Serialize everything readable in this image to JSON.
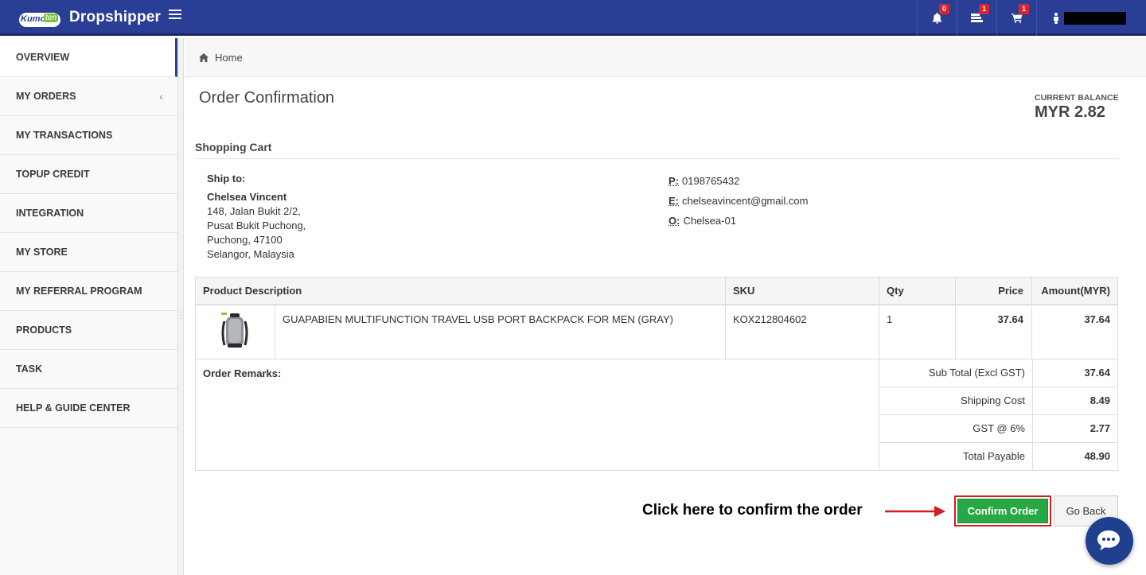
{
  "header": {
    "brand": "Dropshipper",
    "logo_text_a": "Kumo",
    "logo_text_b": "ten",
    "notifications": [
      {
        "icon": "bell-icon",
        "count": "0"
      },
      {
        "icon": "messages-icon",
        "count": "1"
      },
      {
        "icon": "cart-icon",
        "count": "1"
      }
    ],
    "user_icon": "user-icon"
  },
  "sidebar": {
    "items": [
      {
        "label": "OVERVIEW",
        "active": true
      },
      {
        "label": "MY ORDERS",
        "has_chevron": true
      },
      {
        "label": "MY TRANSACTIONS"
      },
      {
        "label": "TOPUP CREDIT"
      },
      {
        "label": "INTEGRATION"
      },
      {
        "label": "MY STORE"
      },
      {
        "label": "MY REFERRAL PROGRAM"
      },
      {
        "label": "PRODUCTS"
      },
      {
        "label": "TASK"
      },
      {
        "label": "HELP & GUIDE CENTER"
      }
    ]
  },
  "breadcrumb": {
    "home": "Home"
  },
  "page": {
    "title": "Order Confirmation",
    "balance_label": "CURRENT BALANCE",
    "balance_value": "MYR 2.82",
    "section_title": "Shopping Cart"
  },
  "shipping": {
    "label": "Ship to:",
    "name": "Chelsea Vincent",
    "address": [
      "148, Jalan Bukit 2/2,",
      "Pusat Bukit Puchong,",
      "Puchong, 47100",
      "Selangor, Malaysia"
    ],
    "phone_key": "P:",
    "phone": "0198765432",
    "email_key": "E:",
    "email": "chelseavincent@gmail.com",
    "order_key": "O:",
    "order_ref": "Chelsea-01"
  },
  "table": {
    "headers": [
      "Product Description",
      "SKU",
      "Qty",
      "Price",
      "Amount(MYR)"
    ],
    "rows": [
      {
        "description": "GUAPABIEN MULTIFUNCTION TRAVEL USB PORT BACKPACK FOR MEN (GRAY)",
        "sku": "KOX212804602",
        "qty": "1",
        "price": "37.64",
        "amount": "37.64"
      }
    ]
  },
  "summary": {
    "remarks_label": "Order Remarks:",
    "rows": [
      {
        "label": "Sub Total (Excl GST)",
        "value": "37.64"
      },
      {
        "label": "Shipping Cost",
        "value": "8.49"
      },
      {
        "label": "GST @ 6%",
        "value": "2.77"
      },
      {
        "label": "Total Payable",
        "value": "48.90"
      }
    ]
  },
  "actions": {
    "annotation": "Click here to confirm the order",
    "confirm": "Confirm Order",
    "back": "Go Back"
  },
  "colors": {
    "header_bg": "#2b3e96",
    "confirm_green": "#27a844",
    "highlight_red": "#d71920",
    "badge_red": "#d9242c"
  }
}
